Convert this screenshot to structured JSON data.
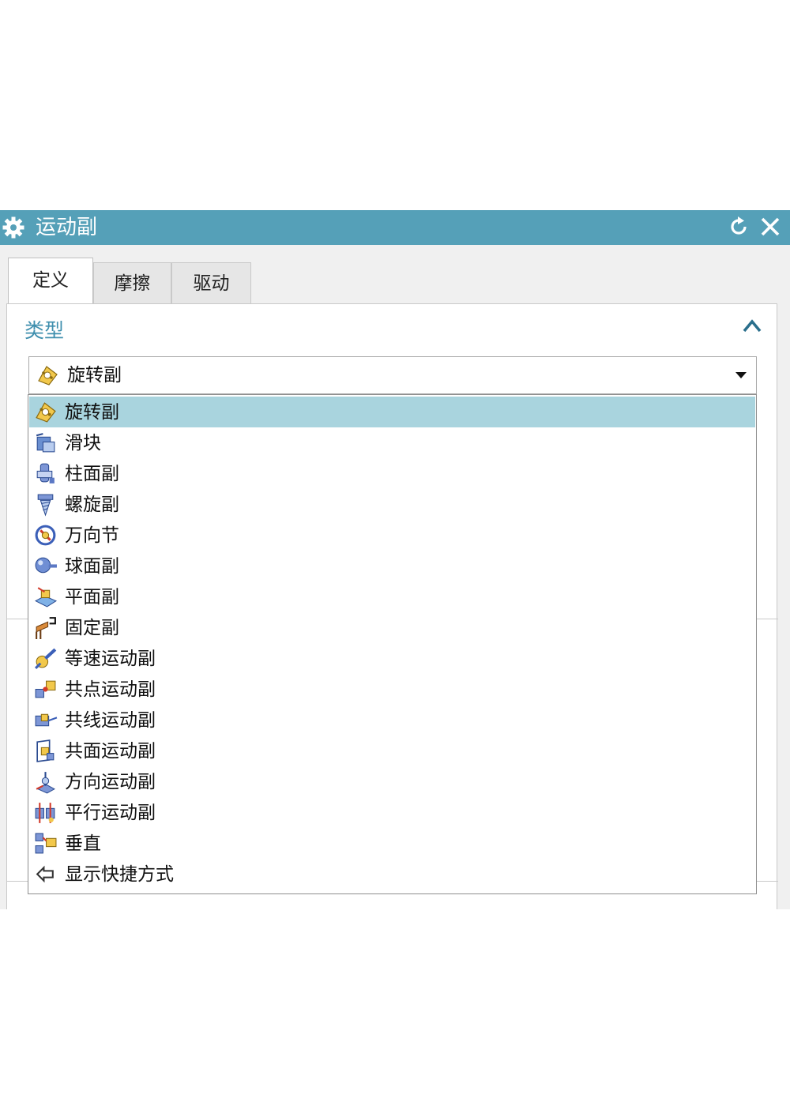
{
  "window": {
    "title": "运动副"
  },
  "tabs": [
    {
      "label": "定义",
      "active": true
    },
    {
      "label": "摩擦",
      "active": false
    },
    {
      "label": "驱动",
      "active": false
    }
  ],
  "type_section": {
    "title": "类型",
    "selected_value": "旋转副"
  },
  "dropdown": {
    "options": [
      {
        "label": "旋转副",
        "icon": "revolute-joint-icon",
        "selected": true
      },
      {
        "label": "滑块",
        "icon": "slider-joint-icon"
      },
      {
        "label": "柱面副",
        "icon": "cylindrical-joint-icon"
      },
      {
        "label": "螺旋副",
        "icon": "screw-joint-icon"
      },
      {
        "label": "万向节",
        "icon": "universal-joint-icon"
      },
      {
        "label": "球面副",
        "icon": "spherical-joint-icon"
      },
      {
        "label": "平面副",
        "icon": "planar-joint-icon"
      },
      {
        "label": "固定副",
        "icon": "fixed-joint-icon"
      },
      {
        "label": "等速运动副",
        "icon": "constant-velocity-joint-icon"
      },
      {
        "label": "共点运动副",
        "icon": "point-on-point-joint-icon"
      },
      {
        "label": "共线运动副",
        "icon": "point-on-line-joint-icon"
      },
      {
        "label": "共面运动副",
        "icon": "point-on-plane-joint-icon"
      },
      {
        "label": "方向运动副",
        "icon": "orientation-joint-icon"
      },
      {
        "label": "平行运动副",
        "icon": "parallel-joint-icon"
      },
      {
        "label": "垂直",
        "icon": "perpendicular-joint-icon"
      },
      {
        "label": "显示快捷方式",
        "icon": "show-shortcuts-arrow-icon"
      }
    ]
  },
  "colors": {
    "titlebar": "#55a0b8",
    "section_title": "#3f8fae",
    "selected_row": "#a9d4de"
  }
}
